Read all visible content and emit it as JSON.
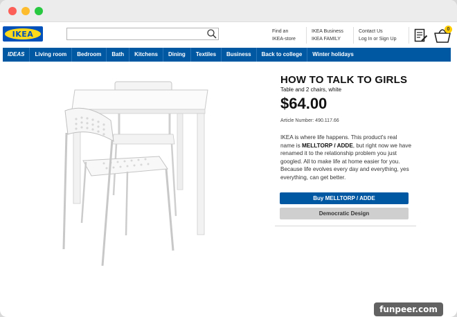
{
  "site": {
    "logo_text": "IKEA"
  },
  "search": {
    "value": "",
    "placeholder": ""
  },
  "header_links": {
    "store_line1": "Find an",
    "store_line2": "IKEA-store",
    "biz_line1": "IKEA Business",
    "biz_line2": "IKEA FAMILY",
    "contact_line1": "Contact Us",
    "contact_line2": "Log In or Sign Up"
  },
  "cart": {
    "count": "0"
  },
  "nav": [
    "IDEAS",
    "Living room",
    "Bedroom",
    "Bath",
    "Kitchens",
    "Dining",
    "Textiles",
    "Business",
    "Back to college",
    "Winter holidays"
  ],
  "product": {
    "title": "HOW TO TALK TO GIRLS",
    "subtitle": "Table and 2 chairs, white",
    "price": "$64.00",
    "article": "Article Number: 490.117.66",
    "desc_part1": "IKEA is where life happens. This product's real name is ",
    "desc_bold": "MELLTORP / ADDE",
    "desc_part2": ", but right now we have renamed it to the relationship problem you just googled. All to make life at home easier for you. Because life evolves every day and everything, yes everything, can get better.",
    "buy_label": "Buy MELLTORP / ADDE",
    "design_label": "Democratic Design"
  },
  "watermark": "funpeer.com",
  "colors": {
    "ikea_blue": "#0058a3",
    "ikea_yellow": "#ffda1a",
    "button_gray": "#cfcfcf"
  },
  "icons": [
    "search-icon",
    "shopping-list-icon",
    "shopping-bag-icon"
  ]
}
